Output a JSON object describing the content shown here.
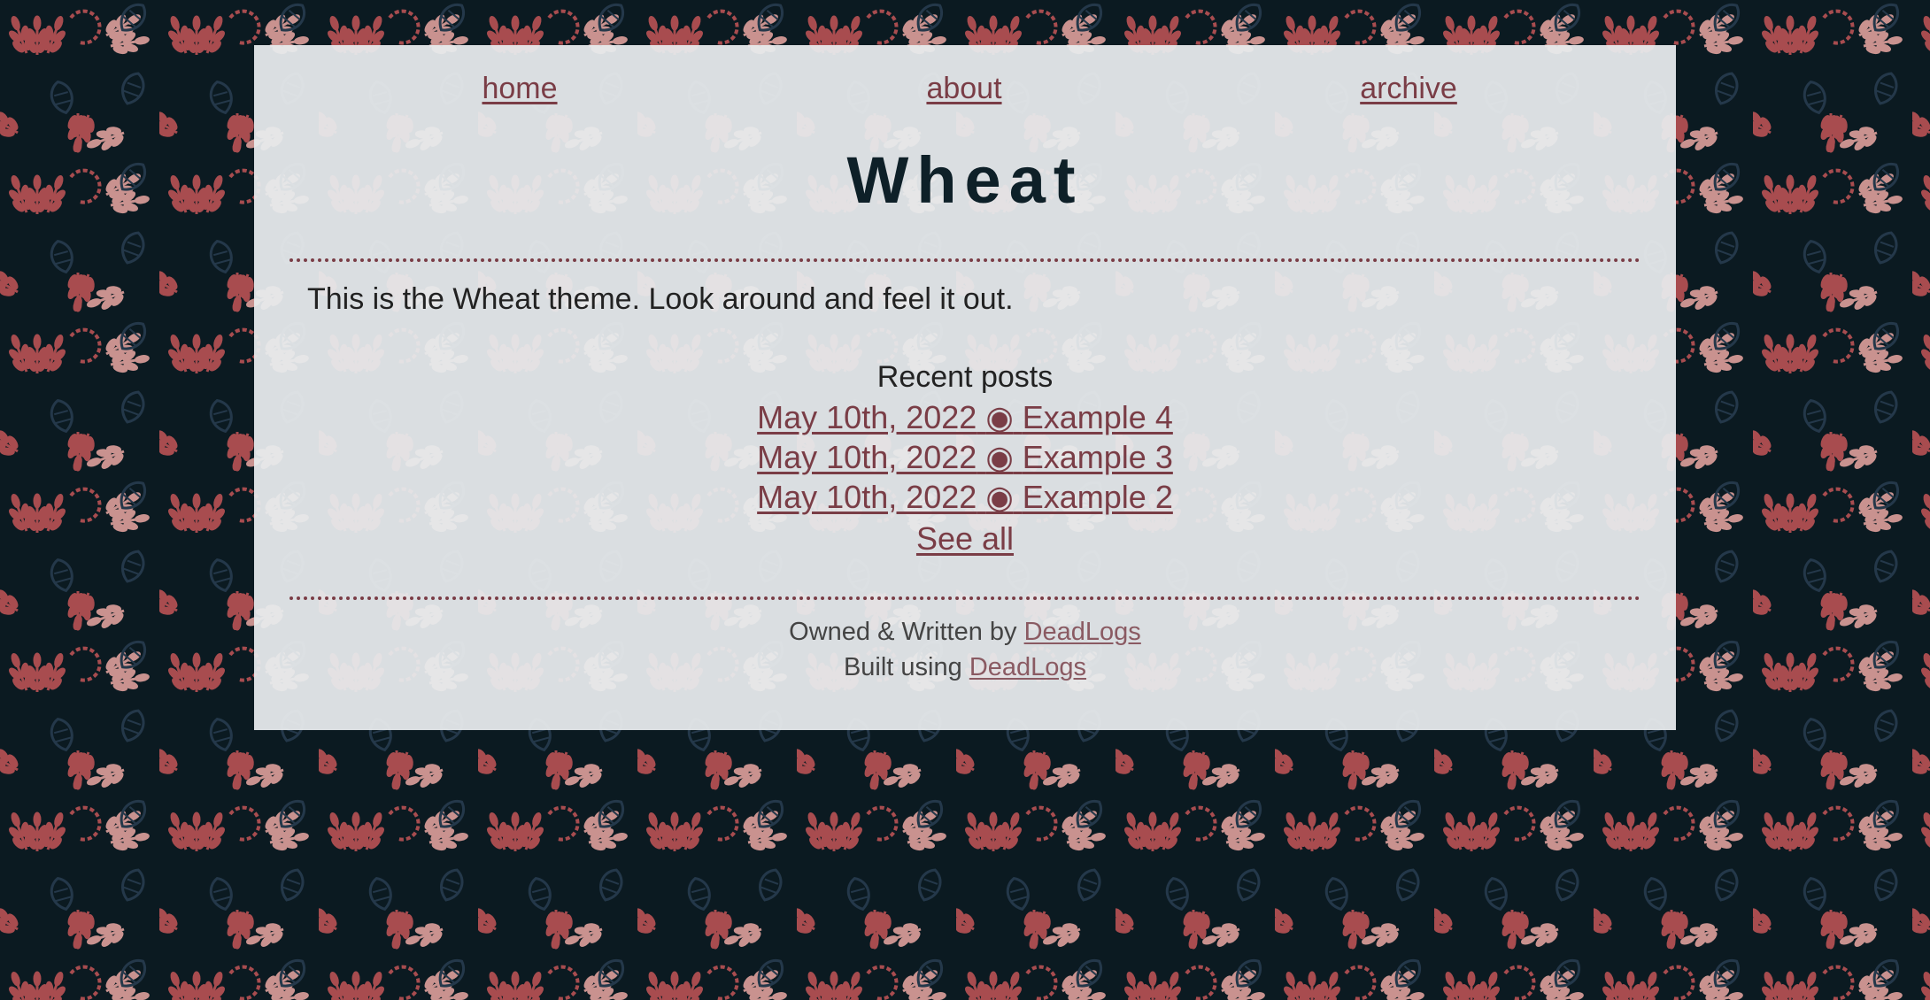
{
  "colors": {
    "page_background": "#0b1a21",
    "card_background": "#e8ebed",
    "link": "#7a3d46",
    "title": "#0e2028",
    "pattern_red": "#a84c4f",
    "pattern_pink": "#c9928f",
    "pattern_blue": "#24384a"
  },
  "nav": {
    "items": [
      {
        "label": "home"
      },
      {
        "label": "about"
      },
      {
        "label": "archive"
      }
    ]
  },
  "site": {
    "title": "Wheat"
  },
  "main": {
    "intro": "This is the Wheat theme. Look around and feel it out.",
    "recent_heading": "Recent posts",
    "posts": [
      {
        "date": "May 10th, 2022",
        "separator": "◉",
        "title": "Example 4"
      },
      {
        "date": "May 10th, 2022",
        "separator": "◉",
        "title": "Example 3"
      },
      {
        "date": "May 10th, 2022",
        "separator": "◉",
        "title": "Example 2"
      }
    ],
    "see_all": "See all"
  },
  "footer": {
    "owned_prefix": "Owned & Written by",
    "owned_link": "DeadLogs",
    "built_prefix": "Built using",
    "built_link": "DeadLogs"
  }
}
